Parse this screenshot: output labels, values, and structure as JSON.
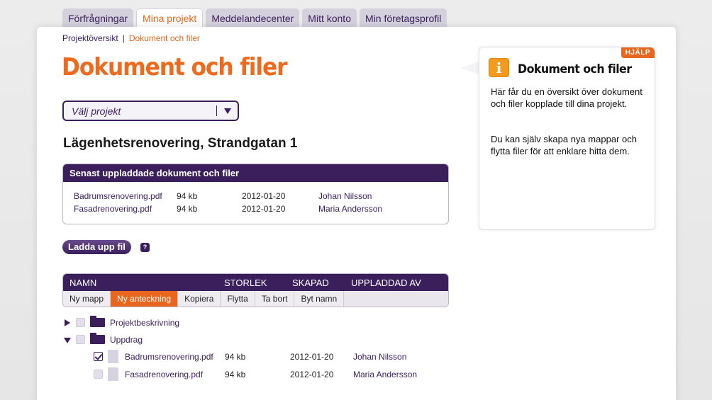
{
  "tabs": [
    {
      "label": "Förfrågningar",
      "active": false
    },
    {
      "label": "Mina projekt",
      "active": true
    },
    {
      "label": "Meddelandecenter",
      "active": false
    },
    {
      "label": "Mitt konto",
      "active": false
    },
    {
      "label": "Min företagsprofil",
      "active": false
    }
  ],
  "breadcrumb": {
    "root": "Projektöversikt",
    "separator": "|",
    "current": "Dokument och filer"
  },
  "page_title": "Dokument och filer",
  "project_select": {
    "placeholder": "Välj projekt"
  },
  "project_title": "Lägenhetsrenovering, Strandgatan 1",
  "recent": {
    "heading": "Senast uppladdade dokument och filer",
    "rows": [
      {
        "file": "Badrumsrenovering.pdf",
        "size": "94 kb",
        "date": "2012-01-20",
        "user": "Johan Nilsson"
      },
      {
        "file": "Fasadrenovering.pdf",
        "size": "94 kb",
        "date": "2012-01-20",
        "user": "Maria Andersson"
      }
    ]
  },
  "upload": {
    "label": "Ladda upp fil",
    "help": "?"
  },
  "file_table": {
    "columns": {
      "name": "NAMN",
      "size": "STORLEK",
      "created": "SKAPAD",
      "uploaded_by": "UPPLADDAD AV"
    },
    "toolbar": [
      {
        "label": "Ny mapp",
        "active": false
      },
      {
        "label": "Ny anteckning",
        "active": true
      },
      {
        "label": "Kopiera",
        "active": false
      },
      {
        "label": "Flytta",
        "active": false
      },
      {
        "label": "Ta bort",
        "active": false
      },
      {
        "label": "Byt namn",
        "active": false
      }
    ]
  },
  "tree": {
    "folders": [
      {
        "name": "Projektbeskrivning",
        "expanded": false
      },
      {
        "name": "Uppdrag",
        "expanded": true
      }
    ],
    "files": [
      {
        "name": "Badrumsrenovering.pdf",
        "size": "94 kb",
        "date": "2012-01-20",
        "user": "Johan Nilsson",
        "checked": true
      },
      {
        "name": "Fasadrenovering.pdf",
        "size": "94 kb",
        "date": "2012-01-20",
        "user": "Maria Andersson",
        "checked": false
      }
    ]
  },
  "help": {
    "badge": "HJÄLP",
    "icon": "info-icon",
    "title": "Dokument och filer",
    "paragraphs": [
      "Här får du en översikt över dokument och filer kopplade till dina projekt.",
      "Du kan själv skapa nya mappar och flytta filer för att enklare hitta dem."
    ]
  },
  "colors": {
    "brand_purple": "#3b1f5c",
    "accent_orange": "#e8661d",
    "info_orange": "#f29b1d"
  }
}
